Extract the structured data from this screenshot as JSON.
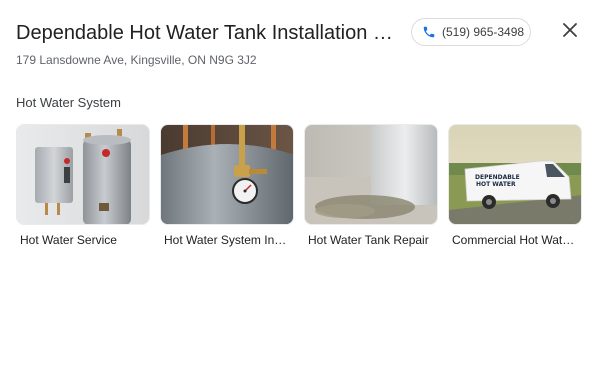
{
  "header": {
    "title": "Dependable Hot Water Tank Installation and...",
    "address": "179 Lansdowne Ave, Kingsville, ON N9G 3J2",
    "phone": "(519) 965-3498",
    "phone_icon": "phone-icon",
    "close_icon": "close-icon"
  },
  "section": {
    "title": "Hot Water System"
  },
  "cards": [
    {
      "label": "Hot Water Service",
      "image": "tankless-and-tank-water-heaters-photo"
    },
    {
      "label": "Hot Water System Inst...",
      "image": "water-heater-pressure-gauge-photo"
    },
    {
      "label": "Hot Water Tank Repair",
      "image": "leaking-tank-puddle-photo"
    },
    {
      "label": "Commercial Hot Water...",
      "image": "service-van-photo"
    }
  ],
  "van_text": [
    "DEPENDABLE",
    "HOT WATER"
  ],
  "colors": {
    "accent_blue": "#1a73e8",
    "text_primary": "#202124",
    "text_secondary": "#5f6368",
    "border": "#dadce0"
  }
}
